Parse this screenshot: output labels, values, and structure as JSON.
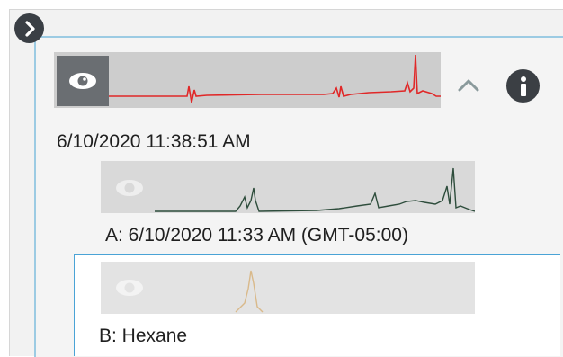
{
  "items": {
    "main": {
      "timestamp": "6/10/2020 11:38:51 AM",
      "trace_color": "#e02828"
    },
    "sample_a": {
      "label": "A: 6/10/2020 11:33 AM (GMT-05:00)",
      "trace_color": "#2e4d3c"
    },
    "sample_b": {
      "label": "B: Hexane",
      "trace_color": "#d9b98a"
    }
  },
  "icons": {
    "expand": "chevron-right-icon",
    "visibility": "eye-icon",
    "collapse": "chevron-up-icon",
    "info": "info-icon"
  },
  "colors": {
    "selection_border": "#4aa3d6",
    "tree_line": "#9ccbe3",
    "icon_dark": "#3a3f45"
  }
}
